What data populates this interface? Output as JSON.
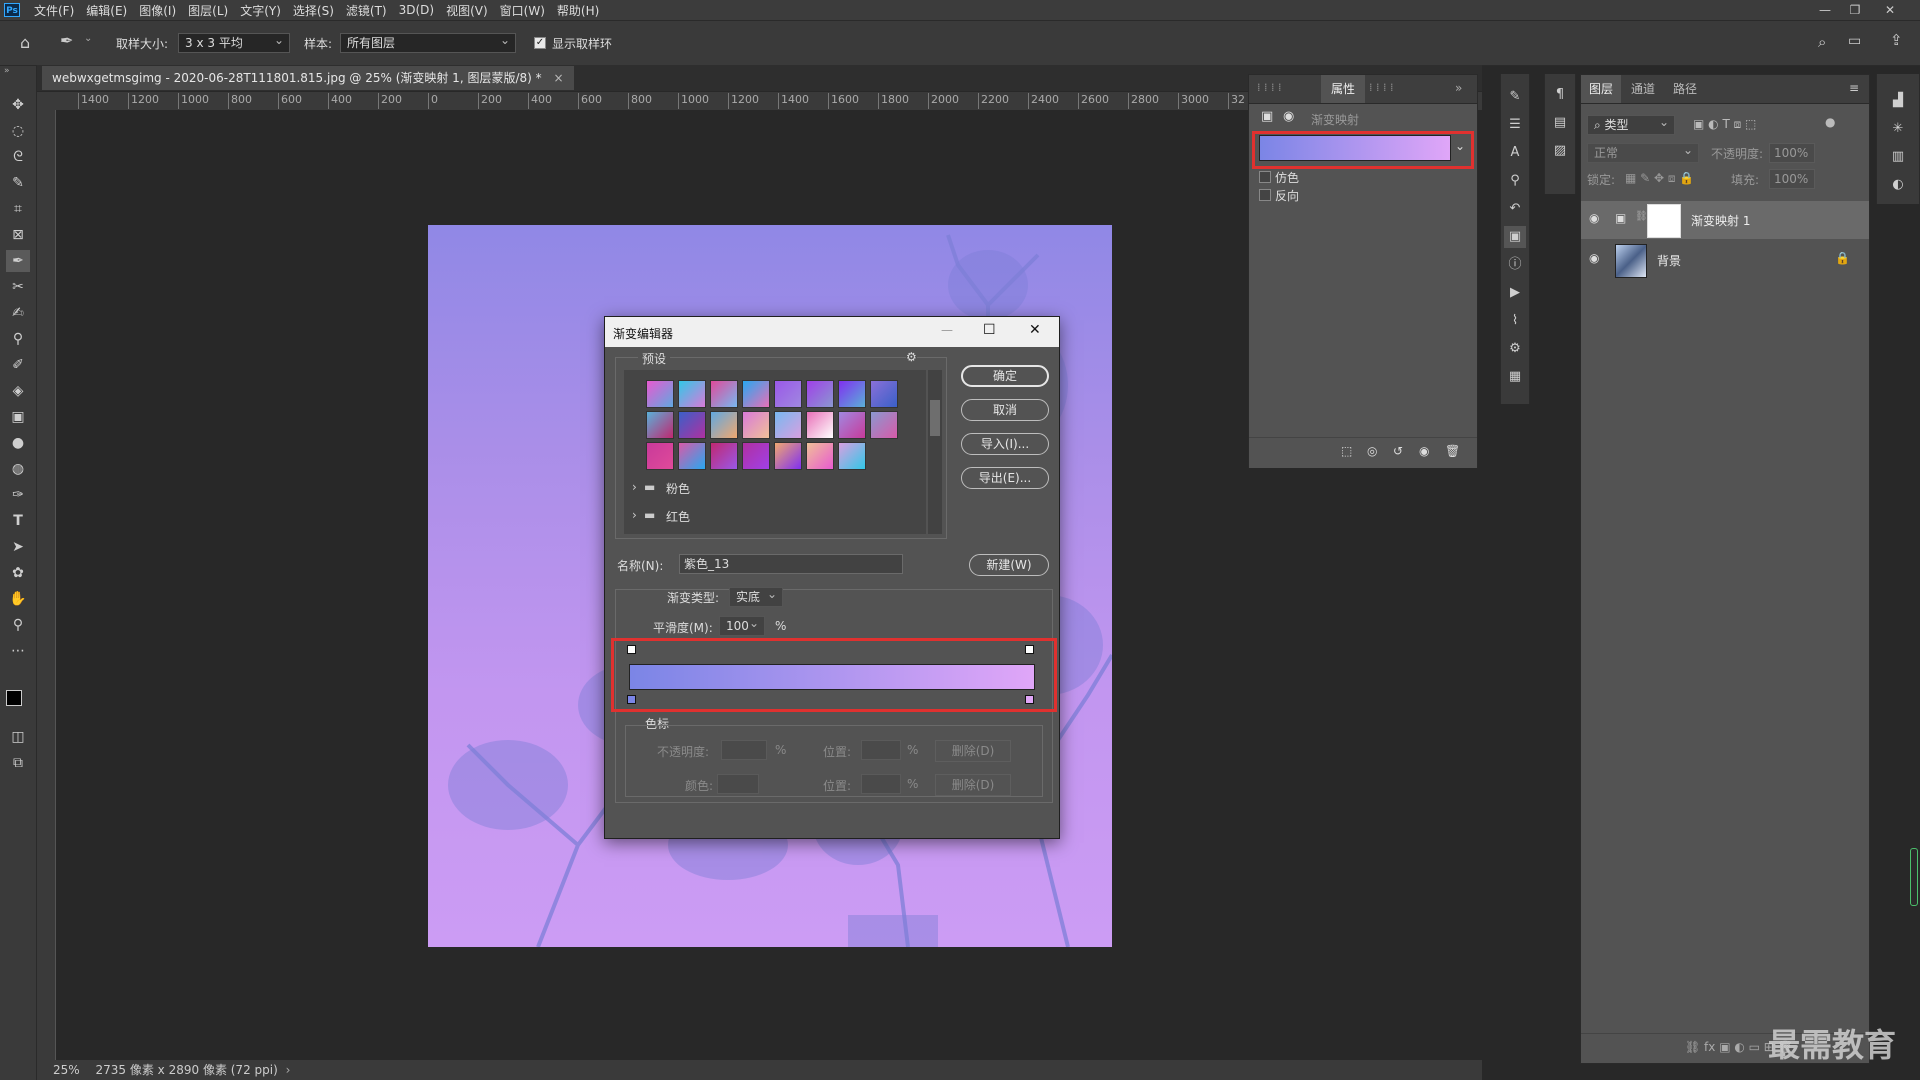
{
  "menu": {
    "logo": "Ps",
    "items": [
      "文件(F)",
      "编辑(E)",
      "图像(I)",
      "图层(L)",
      "文字(Y)",
      "选择(S)",
      "滤镜(T)",
      "3D(D)",
      "视图(V)",
      "窗口(W)",
      "帮助(H)"
    ]
  },
  "options": {
    "sample_size_label": "取样大小:",
    "sample_size_value": "3 x 3 平均",
    "sample_label": "样本:",
    "sample_value": "所有图层",
    "show_ring_label": "显示取样环"
  },
  "document": {
    "tab_title": "webwxgetmsgimg - 2020-06-28T111801.815.jpg @ 25% (渐变映射 1, 图层蒙版/8) *",
    "zoom": "25%",
    "dimensions": "2735 像素 x 2890 像素 (72 ppi)"
  },
  "ruler": {
    "h_ticks": [
      "1400",
      "1200",
      "1000",
      "800",
      "600",
      "400",
      "200",
      "0",
      "200",
      "400",
      "600",
      "800",
      "1000",
      "1200",
      "1400",
      "1600",
      "1800",
      "2000",
      "2200",
      "2400",
      "2600",
      "2800",
      "3000",
      "32"
    ]
  },
  "properties": {
    "tab_label": "属性",
    "layer_type": "渐变映射",
    "dither_label": "仿色",
    "reverse_label": "反向",
    "gradient_start": "#7b85e6",
    "gradient_end": "#e0a6f8"
  },
  "layers_panel": {
    "tabs": [
      "图层",
      "通道",
      "路径"
    ],
    "filter_label": "类型",
    "blend_mode": "正常",
    "opacity_label": "不透明度:",
    "opacity_value": "100%",
    "lock_label": "锁定:",
    "fill_label": "填充:",
    "fill_value": "100%",
    "layers": [
      {
        "name": "渐变映射 1"
      },
      {
        "name": "背景"
      }
    ]
  },
  "dialog": {
    "title": "渐变编辑器",
    "presets_label": "预设",
    "folders": [
      "粉色",
      "红色"
    ],
    "ok": "确定",
    "cancel": "取消",
    "import": "导入(I)...",
    "export": "导出(E)...",
    "name_label": "名称(N):",
    "name_value": "紫色_13",
    "new_button": "新建(W)",
    "type_label": "渐变类型:",
    "type_value": "实底",
    "smooth_label": "平滑度(M):",
    "smooth_value": "100",
    "percent": "%",
    "color_stops_label": "色标",
    "opacity_label": "不透明度:",
    "position_label": "位置:",
    "delete_label": "删除(D)",
    "color_label": "颜色:",
    "swatches": [
      [
        "#e85ad0",
        "#31c8e8",
        "#e04a9a",
        "#28a8f0",
        "#9a58e8",
        "#a040e8",
        "#8030f0",
        "#8a70d8"
      ],
      [
        "#5ab0d8",
        "#3a60c8",
        "#60a8e0",
        "#d87ad8",
        "#78b8f0",
        "#e870b8",
        "#a088e0",
        "#8a98d0"
      ],
      [
        "#c83a9a",
        "#d85aa8",
        "#c02870",
        "#b030a0",
        "#f0a870",
        "#f0c098",
        "#d8a0e0"
      ]
    ]
  },
  "watermark": "最需教育"
}
